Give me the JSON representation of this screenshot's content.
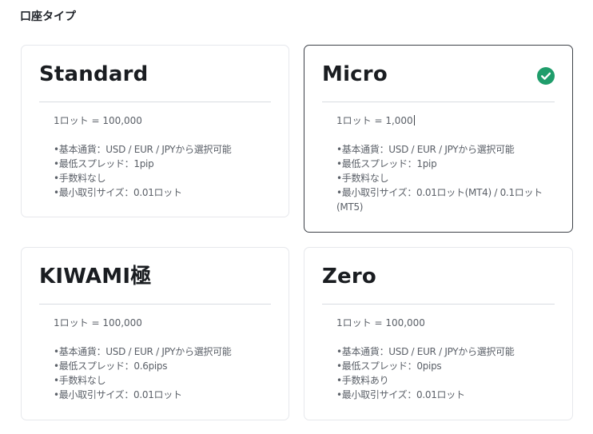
{
  "section": {
    "title": "口座タイプ"
  },
  "accounts": [
    {
      "name": "Standard",
      "lot": "1ロット = 100,000",
      "selected": false,
      "features": [
        "•基本通貨：USD / EUR / JPYから選択可能",
        "•最低スプレッド：1pip",
        "•手数料なし",
        "•最小取引サイズ：0.01ロット"
      ]
    },
    {
      "name": "Micro",
      "lot": "1ロット = 1,000",
      "selected": true,
      "features": [
        "•基本通貨：USD / EUR / JPYから選択可能",
        "•最低スプレッド：1pip",
        "•手数料なし",
        "•最小取引サイズ：0.01ロット(MT4) / 0.1ロット(MT5)"
      ]
    },
    {
      "name": "KIWAMI極",
      "lot": "1ロット = 100,000",
      "selected": false,
      "features": [
        "•基本通貨：USD / EUR / JPYから選択可能",
        "•最低スプレッド：0.6pips",
        "•手数料なし",
        "•最小取引サイズ：0.01ロット"
      ]
    },
    {
      "name": "Zero",
      "lot": "1ロット = 100,000",
      "selected": false,
      "features": [
        "•基本通貨：USD / EUR / JPYから選択可能",
        "•最低スプレッド：0pips",
        "•手数料あり",
        "•最小取引サイズ：0.01ロット"
      ]
    }
  ],
  "icons": {
    "selected": "check-circle-icon"
  },
  "colors": {
    "check_green": "#1f9d6b",
    "selected_border": "#3d4148",
    "card_border": "#e6e8ec",
    "title_text": "#1a1d21",
    "body_text": "#5b6068"
  }
}
